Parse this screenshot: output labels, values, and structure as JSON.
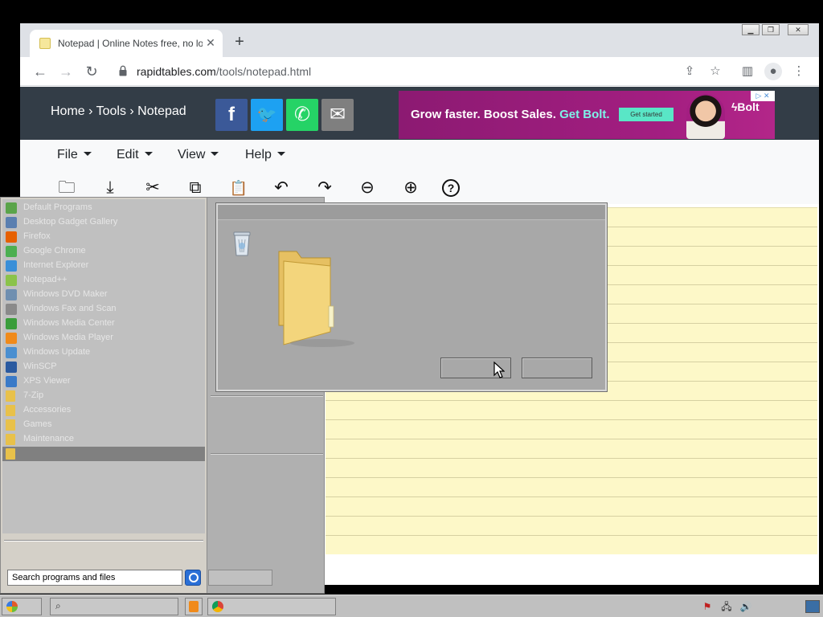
{
  "browser": {
    "tab": {
      "title": "Notepad | Online Notes free, no log",
      "close_glyph": "✕"
    },
    "new_tab_glyph": "+",
    "window_controls": {
      "minimize": "▁",
      "restore": "❐",
      "close": "✕"
    },
    "url": {
      "host": "rapidtables.com",
      "path": "/tools/notepad.html"
    },
    "nav_icons": [
      "back-icon",
      "forward-icon",
      "reload-icon"
    ],
    "toolbar_icons": [
      "share-icon",
      "star-icon",
      "side-panel-icon",
      "profile-icon",
      "more-icon"
    ]
  },
  "site": {
    "breadcrumb": "Home › Tools › Notepad",
    "social": [
      {
        "name": "facebook",
        "glyph": "f",
        "color": "#3b5998"
      },
      {
        "name": "twitter",
        "glyph": "🐦",
        "color": "#1da1f2"
      },
      {
        "name": "whatsapp",
        "glyph": "✆",
        "color": "#25d366"
      },
      {
        "name": "email",
        "glyph": "✉",
        "color": "#7f7f7f"
      }
    ],
    "ad": {
      "text_main": "Grow faster. Boost Sales. ",
      "text_accent": "Get Bolt.",
      "cta": "Get started",
      "brand": "ϟBolt",
      "choice": "▷ ✕"
    }
  },
  "notepad": {
    "menus": [
      "File",
      "Edit",
      "View",
      "Help"
    ],
    "tools": [
      {
        "name": "open-icon",
        "glyph": "🗀"
      },
      {
        "name": "download-icon",
        "glyph": "⤓"
      },
      {
        "name": "cut-icon",
        "glyph": "✂"
      },
      {
        "name": "copy-icon",
        "glyph": "⧉"
      },
      {
        "name": "paste-icon",
        "glyph": "📋"
      },
      {
        "name": "undo-icon",
        "glyph": "↶"
      },
      {
        "name": "redo-icon",
        "glyph": "↷"
      },
      {
        "name": "zoom-out-icon",
        "glyph": "⊖"
      },
      {
        "name": "zoom-in-icon",
        "glyph": "⊕"
      },
      {
        "name": "help-icon",
        "glyph": "?"
      }
    ]
  },
  "start_menu": {
    "programs": [
      {
        "label": "Default Programs",
        "icon": "default-programs-icon",
        "color": "#5aa44a"
      },
      {
        "label": "Desktop Gadget Gallery",
        "icon": "gadget-gallery-icon",
        "color": "#5a7fb0"
      },
      {
        "label": "Firefox",
        "icon": "firefox-icon",
        "color": "#e66000"
      },
      {
        "label": "Google Chrome",
        "icon": "chrome-icon",
        "color": "#4caf50"
      },
      {
        "label": "Internet Explorer",
        "icon": "internet-explorer-icon",
        "color": "#3a8fd8"
      },
      {
        "label": "Notepad++",
        "icon": "notepad-plus-plus-icon",
        "color": "#8bc34a"
      },
      {
        "label": "Windows DVD Maker",
        "icon": "dvd-maker-icon",
        "color": "#6f8fb0"
      },
      {
        "label": "Windows Fax and Scan",
        "icon": "fax-scan-icon",
        "color": "#8a8a8a"
      },
      {
        "label": "Windows Media Center",
        "icon": "media-center-icon",
        "color": "#3a9d3a"
      },
      {
        "label": "Windows Media Player",
        "icon": "media-player-icon",
        "color": "#f08a1a"
      },
      {
        "label": "Windows Update",
        "icon": "windows-update-icon",
        "color": "#4a8fd0"
      },
      {
        "label": "WinSCP",
        "icon": "winscp-icon",
        "color": "#2a5aa0"
      },
      {
        "label": "XPS Viewer",
        "icon": "xps-viewer-icon",
        "color": "#3a7ac8"
      },
      {
        "label": "7-Zip",
        "icon": "folder-icon",
        "color": "#e8c14a"
      },
      {
        "label": "Accessories",
        "icon": "folder-icon",
        "color": "#e8c14a"
      },
      {
        "label": "Games",
        "icon": "folder-icon",
        "color": "#e8c14a"
      },
      {
        "label": "Maintenance",
        "icon": "folder-icon",
        "color": "#e8c14a"
      },
      {
        "label": "",
        "icon": "folder-icon",
        "color": "#e8c14a"
      }
    ],
    "search_placeholder": "Search programs and files"
  },
  "dialog": {
    "title": "",
    "ok_label": "",
    "cancel_label": ""
  },
  "taskbar": {
    "tray_icons": [
      "action-center-flag-icon",
      "network-icon",
      "volume-icon"
    ]
  }
}
